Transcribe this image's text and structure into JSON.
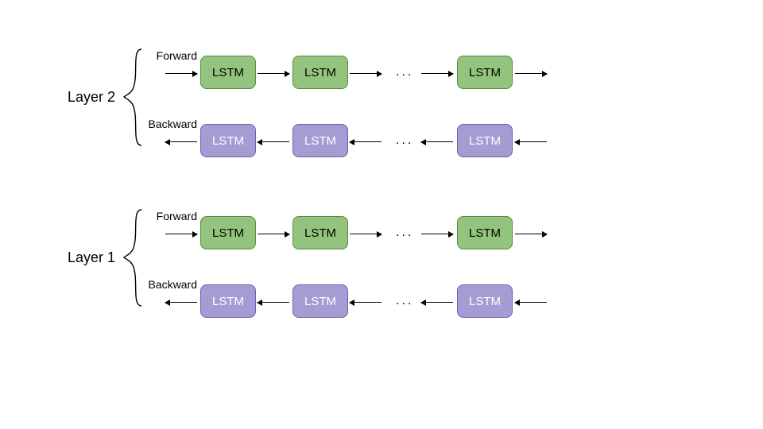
{
  "cell_label": "LSTM",
  "ellipsis": "...",
  "layers": [
    {
      "name": "Layer 2",
      "forward_label": "Forward",
      "backward_label": "Backward"
    },
    {
      "name": "Layer 1",
      "forward_label": "Forward",
      "backward_label": "Backward"
    }
  ],
  "colors": {
    "forward_fill": "#93c47d",
    "backward_fill": "#a59cd4",
    "arrow": "#000000"
  },
  "diagram_meta": {
    "structure": "stacked bidirectional LSTM",
    "num_layers": 2,
    "cells_per_row_visible": 3,
    "directions": [
      "forward",
      "backward"
    ]
  }
}
